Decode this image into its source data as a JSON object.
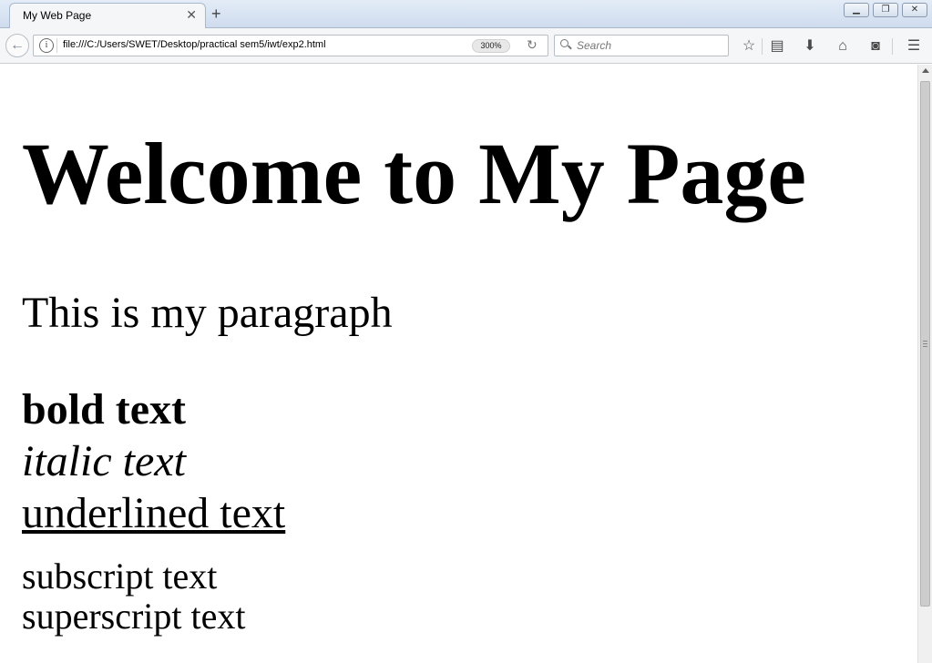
{
  "browser": {
    "tab_title": "My Web Page",
    "url": "file:///C:/Users/SWET/Desktop/practical sem5/iwt/exp2.html",
    "zoom": "300%",
    "search_placeholder": "Search"
  },
  "page": {
    "heading": "Welcome to My Page",
    "paragraph": "This is my paragraph",
    "bold": "bold text",
    "italic": "italic text",
    "underlined": "underlined text",
    "subscript": "subscript text",
    "superscript": "superscript text"
  },
  "icons": [
    "back-arrow-icon",
    "info-icon",
    "reload-icon",
    "search-icon",
    "bookmark-star-icon",
    "reading-list-icon",
    "download-icon",
    "home-icon",
    "pocket-icon",
    "menu-icon"
  ]
}
